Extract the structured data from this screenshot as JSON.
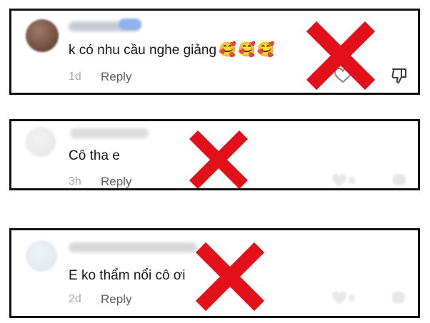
{
  "comments": [
    {
      "text": "k có nhu cầu nghe giảng",
      "emojis": [
        "🥰",
        "🥰",
        "🥰"
      ],
      "time": "1d",
      "reply_label": "Reply",
      "rejected": true
    },
    {
      "text": "Cô tha e",
      "time": "3h",
      "reply_label": "Reply",
      "rejected": true
    },
    {
      "text": "E ko thẩm nổi cô ơi",
      "time": "2d",
      "reply_label": "Reply",
      "rejected": true
    }
  ],
  "colors": {
    "x_mark": "#e3101a",
    "card_border": "#111111",
    "text": "#161616",
    "meta": "#a8a8a8",
    "reply": "#5c5c5c"
  },
  "icons": [
    "heart-icon",
    "thumbs-down-icon",
    "red-x-mark-icon"
  ]
}
